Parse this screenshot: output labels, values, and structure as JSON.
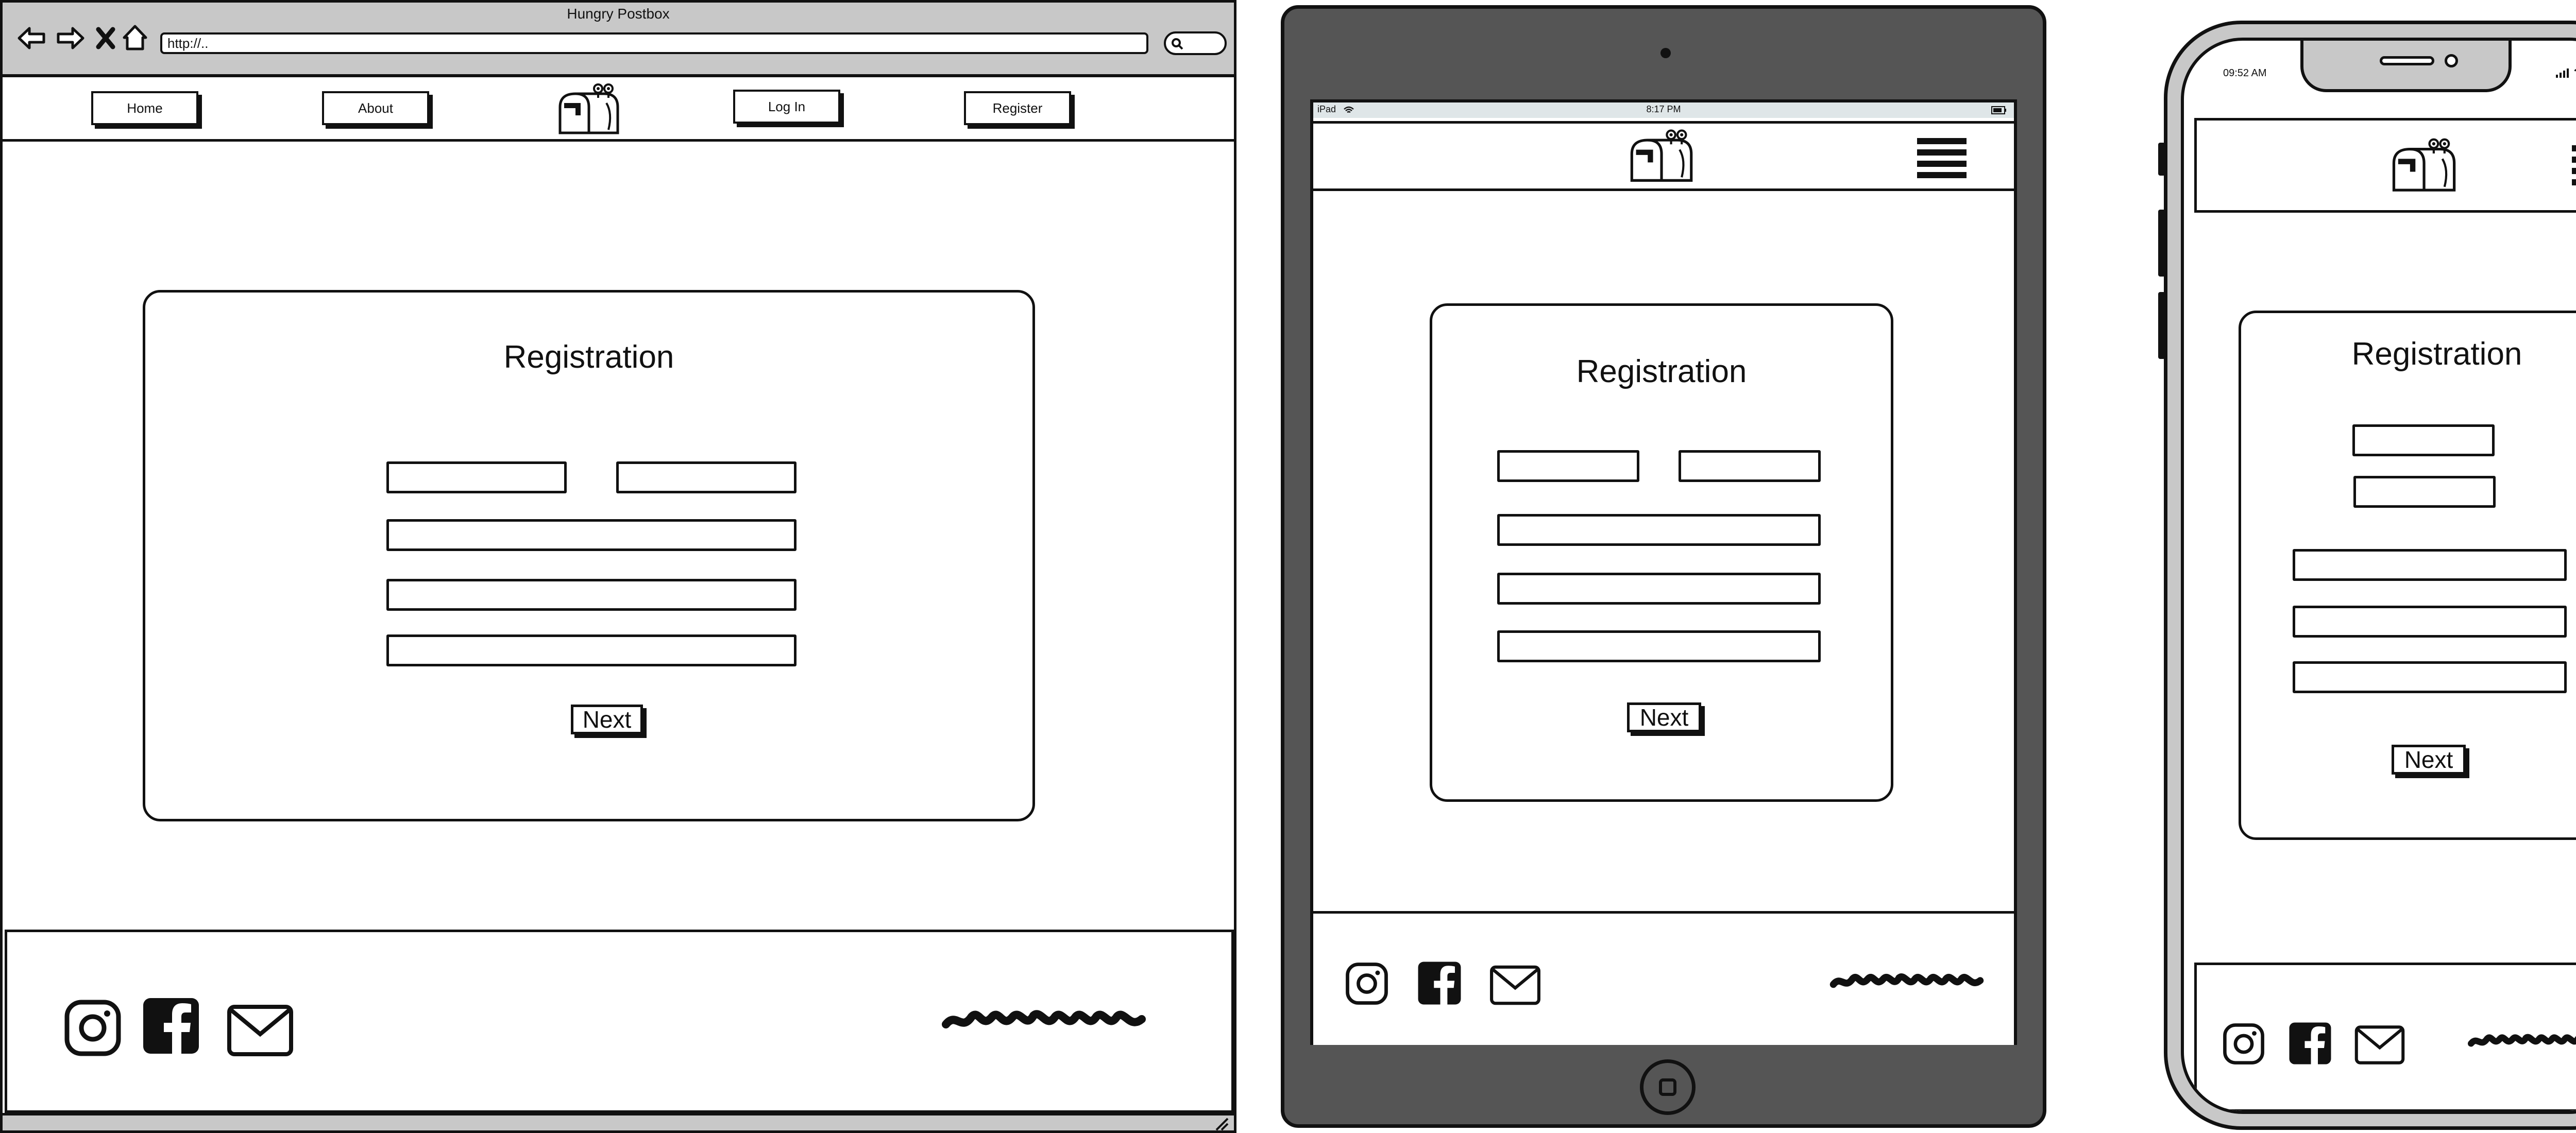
{
  "desktop": {
    "window_title": "Hungry Postbox",
    "address_value": "http://..",
    "nav": [
      {
        "label": "Home"
      },
      {
        "label": "About"
      },
      {
        "label": "Log In"
      },
      {
        "label": "Register"
      }
    ],
    "form": {
      "title": "Registration",
      "next_label": "Next"
    },
    "footer_icons": [
      "instagram-icon",
      "facebook-icon",
      "mail-icon",
      "scribble-signature"
    ]
  },
  "tablet": {
    "status": {
      "carrier": "iPad",
      "time": "8:17 PM"
    },
    "form": {
      "title": "Registration",
      "next_label": "Next"
    },
    "footer_icons": [
      "instagram-icon",
      "facebook-icon",
      "mail-icon",
      "scribble-signature"
    ]
  },
  "phone": {
    "status": {
      "time": "09:52 AM"
    },
    "form": {
      "title": "Registration",
      "next_label": "Next"
    },
    "footer_icons": [
      "instagram-icon",
      "facebook-icon",
      "mail-icon",
      "scribble-signature"
    ]
  },
  "colors": {
    "chrome": "#c8c8c8",
    "tablet_body": "#555555",
    "ink": "#111111"
  }
}
